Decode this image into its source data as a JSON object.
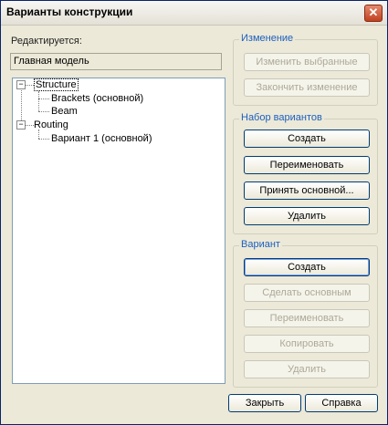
{
  "window": {
    "title": "Варианты конструкции"
  },
  "editing": {
    "label": "Редактируется:",
    "value": "Главная модель"
  },
  "tree": {
    "nodes": [
      {
        "label": "Structure"
      },
      {
        "label": "Brackets (основной)"
      },
      {
        "label": "Beam"
      },
      {
        "label": "Routing"
      },
      {
        "label": "Вариант 1 (основной)"
      }
    ]
  },
  "change_group": {
    "title": "Изменение",
    "edit_selected": "Изменить выбранные",
    "finish_edit": "Закончить изменение"
  },
  "set_group": {
    "title": "Набор вариантов",
    "create": "Создать",
    "rename": "Переименовать",
    "accept_primary": "Принять основной...",
    "delete": "Удалить"
  },
  "option_group": {
    "title": "Вариант",
    "create": "Создать",
    "make_primary": "Сделать основным",
    "rename": "Переименовать",
    "copy": "Копировать",
    "delete": "Удалить"
  },
  "footer": {
    "close": "Закрыть",
    "help": "Справка"
  }
}
